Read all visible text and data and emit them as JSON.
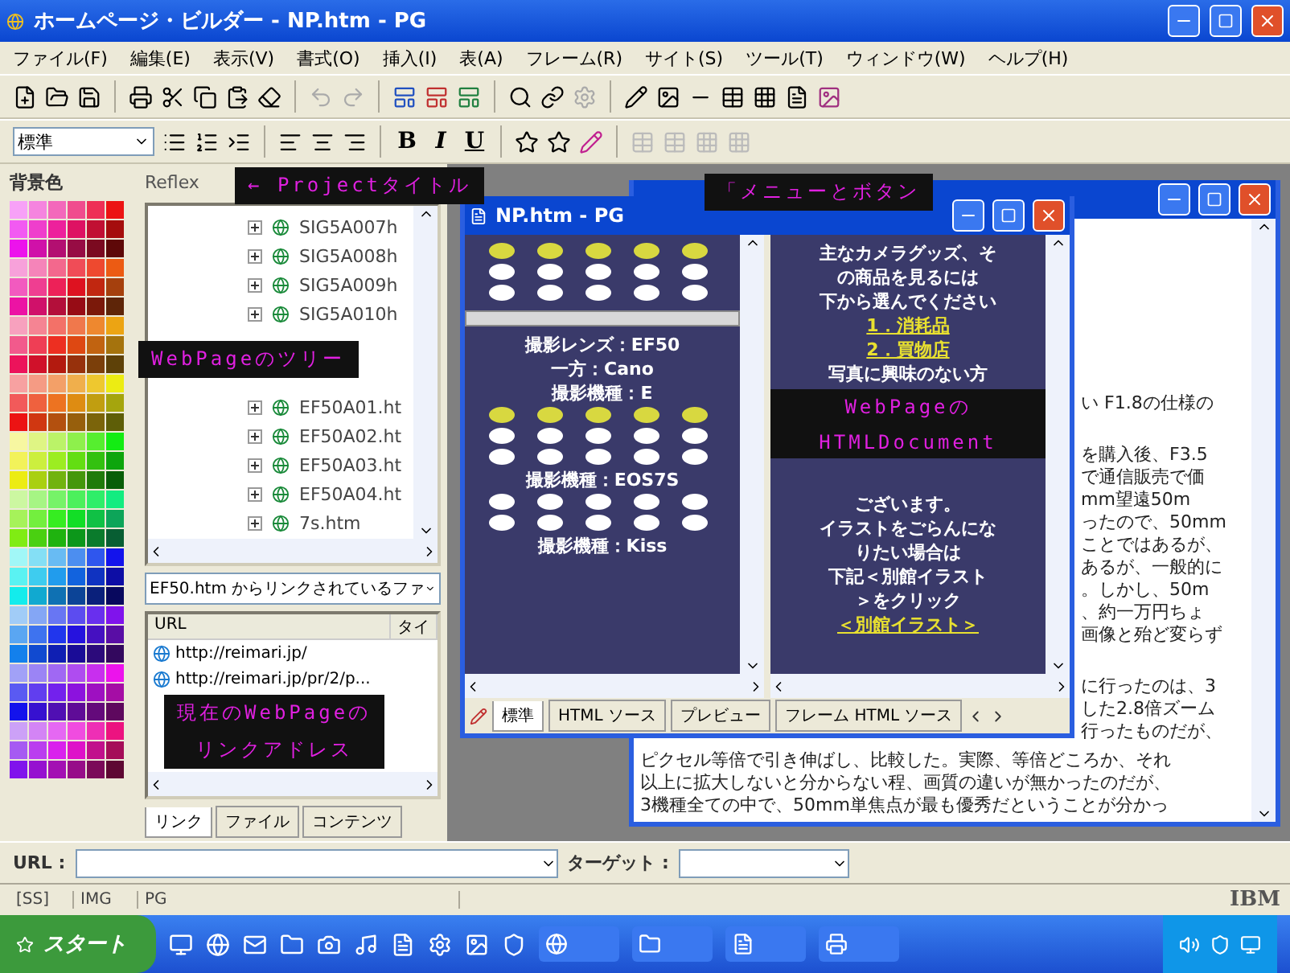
{
  "window": {
    "title": "ホームページ・ビルダー - NP.htm - PG"
  },
  "menu": [
    "ファイル(F)",
    "編集(E)",
    "表示(V)",
    "書式(O)",
    "挿入(I)",
    "表(A)",
    "フレーム(R)",
    "サイト(S)",
    "ツール(T)",
    "ウィンドウ(W)",
    "ヘルプ(H)"
  ],
  "format_toolbar": {
    "style_select": "標準",
    "text_buttons": [
      {
        "label": "B",
        "kind": "bold"
      },
      {
        "label": "I",
        "kind": "italic"
      },
      {
        "label": "U",
        "kind": "underline"
      }
    ]
  },
  "palette": {
    "title": "背景色"
  },
  "site_panel": {
    "project": "Reflex",
    "tree_top": [
      {
        "label": "SIG5A007h",
        "expanded": false
      },
      {
        "label": "SIG5A008h",
        "expanded": false
      },
      {
        "label": "SIG5A009h",
        "expanded": false
      },
      {
        "label": "SIG5A010h",
        "expanded": false
      }
    ],
    "tree_bottom": [
      {
        "label": "EF50A01.ht",
        "expanded": false
      },
      {
        "label": "EF50A02.ht",
        "expanded": false
      },
      {
        "label": "EF50A03.ht",
        "expanded": false
      },
      {
        "label": "EF50A04.ht",
        "expanded": false
      },
      {
        "label": "7s.htm",
        "expanded": false
      }
    ],
    "link_source": "EF50.htm からリンクされているファ",
    "link_columns": [
      "URL",
      "タイ"
    ],
    "links": [
      "http://reimari.jp/",
      "http://reimari.jp/pr/2/p..."
    ],
    "tabs": [
      {
        "label": "リンク",
        "selected": true
      },
      {
        "label": "ファイル",
        "selected": false
      },
      {
        "label": "コンテンツ",
        "selected": false
      }
    ]
  },
  "document_window": {
    "upper_groups": [
      [
        "い F1.8の仕様の"
      ],
      [
        "を購入後、F3.5",
        "で通信販売で価",
        "mm望遠50m",
        "ったので、50mm",
        "ことではあるが、",
        "あるが、一般的に",
        "。しかし、50m",
        "、約一万円ちょ",
        "画像と殆ど変らず"
      ],
      [
        "に行ったのは、3",
        "した2.8倍ズーム",
        "行ったものだが、"
      ]
    ],
    "lower_lines": [
      "ピクセル等倍で引き伸ばし、比較した。実際、等倍どころか、それ",
      "以上に拡大しないと分からない程、画質の違いが無かったのだが、",
      "3機種全ての中で、50mm単焦点が最も優秀だということが分かっ"
    ]
  },
  "editor_window": {
    "title": "NP.htm - PG",
    "left_pane": [
      {
        "kind": "dots",
        "marked": true
      },
      {
        "kind": "bar"
      },
      {
        "kind": "text",
        "text": "撮影レンズ：EF50"
      },
      {
        "kind": "text",
        "text": "一方：Cano"
      },
      {
        "kind": "text",
        "text": "撮影機種：E"
      },
      {
        "kind": "dots",
        "marked": true
      },
      {
        "kind": "text",
        "text": "撮影機種：EOS7S"
      },
      {
        "kind": "dots",
        "marked": false
      },
      {
        "kind": "text",
        "text": "撮影機種：Kiss"
      }
    ],
    "right_pane_top": [
      {
        "kind": "text",
        "text": "主なカメラグッズ、そ"
      },
      {
        "kind": "text",
        "text": "の商品を見るには"
      },
      {
        "kind": "text",
        "text": "下から選んでください"
      },
      {
        "kind": "link",
        "text": "1．消耗品"
      },
      {
        "kind": "link",
        "text": "2．買物店"
      },
      {
        "kind": "text",
        "text": "写真に興味のない方"
      }
    ],
    "right_pane_bottom": [
      {
        "kind": "text",
        "text": "ございます。"
      },
      {
        "kind": "text",
        "text": "イラストをごらんにな"
      },
      {
        "kind": "text",
        "text": "りたい場合は"
      },
      {
        "kind": "text",
        "text": "下記＜別館イラスト"
      },
      {
        "kind": "text",
        "text": "＞をクリック"
      },
      {
        "kind": "link",
        "text": "＜別館イラスト＞"
      }
    ],
    "tabs": [
      {
        "label": "標準",
        "selected": true
      },
      {
        "label": "HTML ソース",
        "selected": false
      },
      {
        "label": "プレビュー",
        "selected": false
      },
      {
        "label": "フレーム HTML ソース",
        "selected": false
      }
    ]
  },
  "url_bar": {
    "url_label": "URL :",
    "target_label": "ターゲット :"
  },
  "status_bar": [
    "[SS]",
    "IMG",
    "PG"
  ],
  "brand": "IBM",
  "taskbar": {
    "start": "スタート"
  },
  "annotations": [
    {
      "kind": "project",
      "lines": [
        "← Projectタイトル"
      ]
    },
    {
      "kind": "menu",
      "lines": [
        "「メニューとボタン"
      ]
    },
    {
      "kind": "tree",
      "lines": [
        "WebPageのツリー"
      ]
    },
    {
      "kind": "document",
      "lines": [
        "WebPageの",
        "HTMLDocument"
      ]
    },
    {
      "kind": "links",
      "lines": [
        "現在のWebPageの",
        "リンクアドレス"
      ]
    }
  ]
}
